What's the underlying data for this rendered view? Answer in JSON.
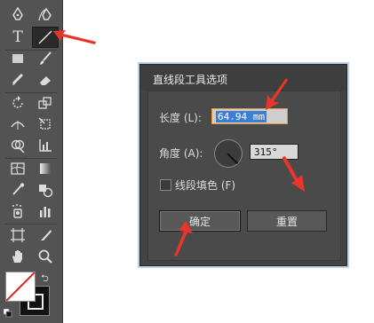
{
  "toolbar": {
    "tools": [
      {
        "name": "pen-tool",
        "icon": "pen-icon"
      },
      {
        "name": "curvature-pen-tool",
        "icon": "curvature-pen-icon"
      },
      {
        "name": "type-tool",
        "icon": "type-icon",
        "label": "T"
      },
      {
        "name": "line-segment-tool",
        "icon": "line-segment-icon",
        "selected": true
      },
      {
        "name": "rectangle-tool",
        "icon": "rectangle-icon"
      },
      {
        "name": "paintbrush-tool",
        "icon": "paintbrush-icon"
      },
      {
        "name": "pencil-tool",
        "icon": "pencil-icon"
      },
      {
        "name": "eraser-tool",
        "icon": "eraser-icon"
      },
      {
        "name": "rotate-tool",
        "icon": "rotate-icon"
      },
      {
        "name": "scale-tool",
        "icon": "scale-icon"
      },
      {
        "name": "width-tool",
        "icon": "width-icon"
      },
      {
        "name": "free-transform-tool",
        "icon": "free-transform-icon"
      },
      {
        "name": "shape-builder-tool",
        "icon": "shape-builder-icon"
      },
      {
        "name": "graph-tool",
        "icon": "graph-icon"
      },
      {
        "name": "mesh-tool",
        "icon": "mesh-icon"
      },
      {
        "name": "gradient-tool",
        "icon": "gradient-icon"
      },
      {
        "name": "eyedropper-tool",
        "icon": "eyedropper-icon"
      },
      {
        "name": "blend-tool",
        "icon": "blend-icon"
      },
      {
        "name": "symbol-sprayer-tool",
        "icon": "symbol-sprayer-icon"
      },
      {
        "name": "column-graph-tool",
        "icon": "column-graph-icon"
      },
      {
        "name": "artboard-tool",
        "icon": "artboard-icon"
      },
      {
        "name": "slice-tool",
        "icon": "slice-icon"
      },
      {
        "name": "hand-tool",
        "icon": "hand-icon"
      },
      {
        "name": "zoom-tool",
        "icon": "zoom-icon"
      }
    ],
    "colors": {
      "fill": "#ffffff",
      "stroke": "#111111",
      "none_slash": "#e02020"
    }
  },
  "dialog": {
    "title": "直线段工具选项",
    "length_label": "长度 (L):",
    "length_value": "64.94 mm",
    "angle_label": "角度 (A):",
    "angle_value": "315°",
    "fill_checkbox_label": "线段填色 (F)",
    "fill_checked": false,
    "ok_label": "确定",
    "reset_label": "重置"
  },
  "annotations": {
    "arrow_color": "#e8352c"
  }
}
